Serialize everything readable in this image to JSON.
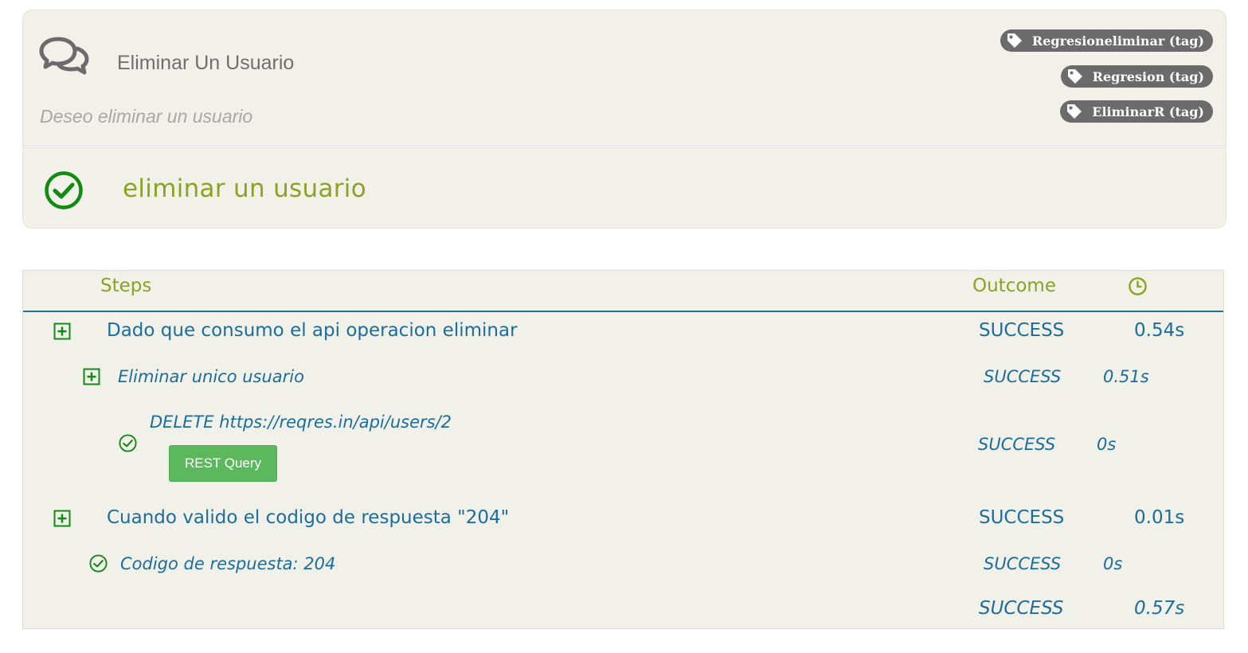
{
  "story": {
    "title": "Eliminar Un Usuario",
    "description": "Deseo eliminar un usuario",
    "tags": [
      "Regresioneliminar (tag)",
      "Regresion (tag)",
      "EliminarR (tag)"
    ]
  },
  "scenario": {
    "title": "eliminar un usuario",
    "status_icon": "check-circle-icon"
  },
  "steps_table": {
    "headers": {
      "steps": "Steps",
      "outcome": "Outcome",
      "duration_icon": "clock-icon"
    },
    "rows": [
      {
        "text": "Dado que consumo el api operacion eliminar",
        "outcome": "SUCCESS",
        "duration": "0.54s",
        "icon": "expand-plus-icon"
      },
      {
        "text": "Eliminar unico usuario",
        "outcome": "SUCCESS",
        "duration": "0.51s",
        "icon": "expand-plus-icon"
      },
      {
        "text": "DELETE https://reqres.in/api/users/2",
        "outcome": "SUCCESS",
        "duration": "0s",
        "icon": "check-circle-icon",
        "button": "REST Query"
      },
      {
        "text": "Cuando valido el codigo de respuesta \"204\"",
        "outcome": "SUCCESS",
        "duration": "0.01s",
        "icon": "expand-plus-icon"
      },
      {
        "text": "Codigo de respuesta: 204",
        "outcome": "SUCCESS",
        "duration": "0s",
        "icon": "check-circle-icon"
      }
    ],
    "total": {
      "outcome": "SUCCESS",
      "duration": "0.57s"
    }
  },
  "colors": {
    "accent_green": "#8aa322",
    "success_icon": "#138a13",
    "step_text": "#1b6d9c",
    "tag_bg": "#6b6b6b",
    "button_bg": "#5cb85c",
    "panel_bg": "#f1f1ea"
  }
}
